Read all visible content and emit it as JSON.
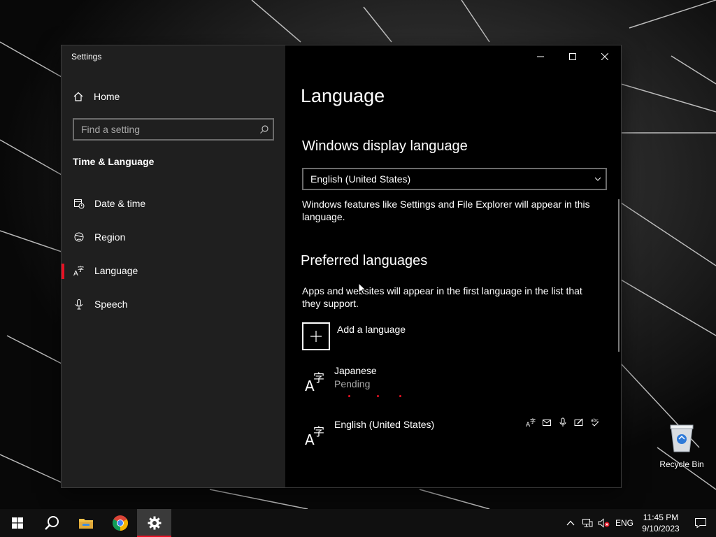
{
  "window": {
    "title": "Settings"
  },
  "nav": {
    "home_label": "Home",
    "search_placeholder": "Find a setting",
    "section": "Time & Language",
    "items": [
      {
        "label": "Date & time",
        "icon": "calendar-clock-icon"
      },
      {
        "label": "Region",
        "icon": "globe-icon"
      },
      {
        "label": "Language",
        "icon": "language-icon",
        "active": true
      },
      {
        "label": "Speech",
        "icon": "microphone-icon"
      }
    ]
  },
  "content": {
    "page_title": "Language",
    "display_lang_heading": "Windows display language",
    "display_lang_value": "English (United States)",
    "display_lang_desc": "Windows features like Settings and File Explorer will appear in this language.",
    "preferred_heading": "Preferred languages",
    "preferred_desc": "Apps and websites will appear in the first language in the list that they support.",
    "add_language_label": "Add a language",
    "languages": [
      {
        "name": "Japanese",
        "status": "Pending"
      },
      {
        "name": "English (United States)",
        "status": ""
      }
    ],
    "feature_icons": [
      "display-language-icon",
      "speech-icon",
      "microphone-icon",
      "handwriting-icon",
      "spellcheck-icon"
    ]
  },
  "desktop": {
    "recycle_bin_label": "Recycle Bin"
  },
  "taskbar": {
    "apps": [
      "start-icon",
      "search-icon",
      "file-explorer-icon",
      "chrome-icon",
      "settings-icon"
    ],
    "input_language": "ENG",
    "time": "11:45 PM",
    "date": "9/10/2023"
  },
  "colors": {
    "accent": "#e81123",
    "nav_bg": "#1f1f1f",
    "content_bg": "#000000"
  }
}
